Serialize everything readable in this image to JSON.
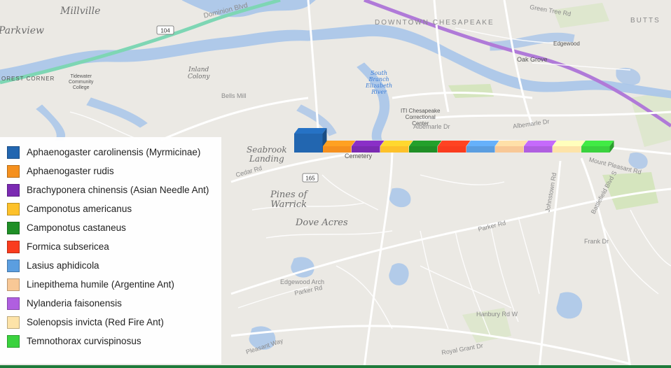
{
  "map": {
    "places": [
      {
        "id": "millville",
        "text": "Millville"
      },
      {
        "id": "parkview",
        "text": "Parkview"
      },
      {
        "id": "inland-colony",
        "text": "Inland\nColony"
      },
      {
        "id": "south-branch",
        "text": "South\nBranch\nElizabeth\nRiver"
      },
      {
        "id": "oak-grove",
        "text": "Oak Grove"
      },
      {
        "id": "edgewood",
        "text": "Edgewood"
      },
      {
        "id": "downtown",
        "text": "DOWNTOWN CHESAPEAKE"
      },
      {
        "id": "butts",
        "text": "BUTTS"
      },
      {
        "id": "seabrook",
        "text": "Seabrook\nLanding"
      },
      {
        "id": "pines",
        "text": "Pines of\nWarrick"
      },
      {
        "id": "dove-acres",
        "text": "Dove Acres"
      },
      {
        "id": "cemetery",
        "text": "Cemetery"
      },
      {
        "id": "iti",
        "text": "ITI Chesapeake\nCorrectional\nCenter"
      },
      {
        "id": "tidewater",
        "text": "Tidewater\nCommunity\nCollege"
      },
      {
        "id": "corner",
        "text": "OREST CORNER"
      }
    ],
    "streets": [
      {
        "id": "dominion",
        "text": "Dominion Blvd"
      },
      {
        "id": "bells-mill",
        "text": "Bells Mill"
      },
      {
        "id": "cedar-rd",
        "text": "Cedar Rd"
      },
      {
        "id": "parker-rd",
        "text": "Parker Rd"
      },
      {
        "id": "parker-rd-2",
        "text": "Parker Rd"
      },
      {
        "id": "albemarle",
        "text": "Albemarle Dr"
      },
      {
        "id": "albemarle-2",
        "text": "Albemarle Dr"
      },
      {
        "id": "mount-pleasant",
        "text": "Mount Pleasant Rd"
      },
      {
        "id": "johnstown",
        "text": "Johnstown Rd"
      },
      {
        "id": "battlefield",
        "text": "Battlefield Blvd S"
      },
      {
        "id": "green-tree",
        "text": "Green Tree Rd"
      },
      {
        "id": "hanbury",
        "text": "Hanbury Rd W"
      },
      {
        "id": "royal-grant",
        "text": "Royal Grant Dr"
      },
      {
        "id": "pleasant-way",
        "text": "Pleasant Way"
      },
      {
        "id": "edgewood-arch",
        "text": "Edgewood Arch"
      },
      {
        "id": "frank-dr",
        "text": "Frank Dr"
      }
    ],
    "shields": [
      {
        "id": "shield-104",
        "text": "104"
      },
      {
        "id": "shield-165",
        "text": "165"
      }
    ]
  },
  "legend": {
    "items": [
      {
        "label": "Aphaenogaster carolinensis (Myrmicinae)",
        "color": "#2266b0"
      },
      {
        "label": "Aphaenogaster rudis",
        "color": "#f5901e"
      },
      {
        "label": "Brachyponera chinensis (Asian Needle Ant)",
        "color": "#7b2ab2"
      },
      {
        "label": "Camponotus americanus",
        "color": "#fdc12a"
      },
      {
        "label": "Camponotus castaneus",
        "color": "#1f8f26"
      },
      {
        "label": "Formica subsericea",
        "color": "#fa3c1e"
      },
      {
        "label": "Lasius aphidicola",
        "color": "#5b9ee0"
      },
      {
        "label": "Linepithema humile (Argentine Ant)",
        "color": "#f8c896"
      },
      {
        "label": "Nylanderia faisonensis",
        "color": "#b05fe0"
      },
      {
        "label": "Solenopsis invicta (Red Fire Ant)",
        "color": "#fde3a8"
      },
      {
        "label": "Temnothorax curvispinosus",
        "color": "#3ad23e"
      }
    ]
  },
  "chart_data": {
    "type": "bar",
    "categories": [
      "Aphaenogaster carolinensis (Myrmicinae)",
      "Aphaenogaster rudis",
      "Brachyponera chinensis (Asian Needle Ant)",
      "Camponotus americanus",
      "Camponotus castaneus",
      "Formica subsericea",
      "Lasius aphidicola",
      "Linepithema humile (Argentine Ant)",
      "Nylanderia faisonensis",
      "Solenopsis invicta (Red Fire Ant)",
      "Temnothorax curvispinosus"
    ],
    "values": [
      3,
      1,
      1,
      1,
      1,
      1,
      1,
      1,
      1,
      1,
      1
    ],
    "colors": [
      "#2266b0",
      "#f5901e",
      "#7b2ab2",
      "#fdc12a",
      "#1f8f26",
      "#fa3c1e",
      "#5b9ee0",
      "#f8c896",
      "#b05fe0",
      "#fde3a8",
      "#3ad23e"
    ],
    "legend_position": "left"
  }
}
